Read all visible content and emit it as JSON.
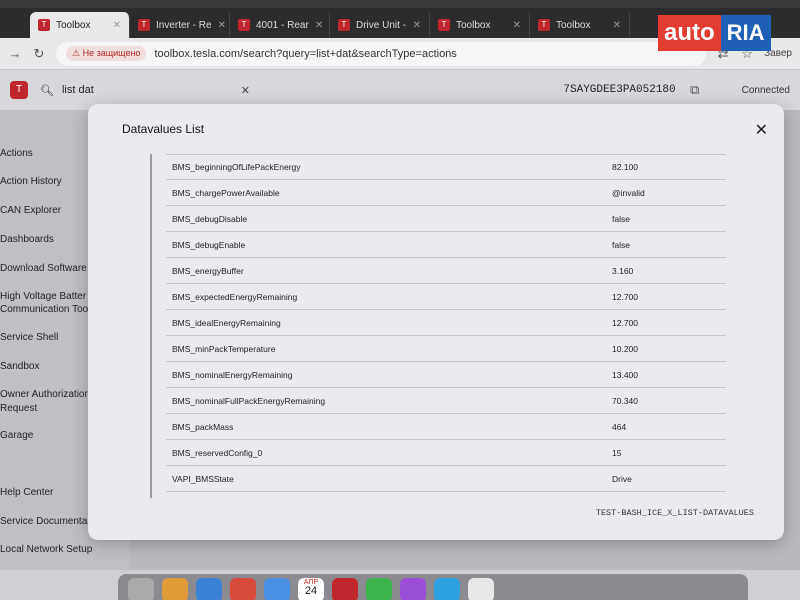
{
  "browser": {
    "tabs": [
      {
        "label": "Toolbox",
        "active": true
      },
      {
        "label": "Inverter - Re"
      },
      {
        "label": "4001 - Rear"
      },
      {
        "label": "Drive Unit -"
      },
      {
        "label": "Toolbox"
      },
      {
        "label": "Toolbox"
      }
    ],
    "security_label": "Не защищено",
    "url": "toolbox.tesla.com/search?query=list+dat&searchType=actions",
    "profile_label": "Завер"
  },
  "watermark": {
    "part1": "auto",
    "part2": "RIA"
  },
  "app": {
    "search_value": "list dat",
    "vin": "7SAYGDEE3PA052180",
    "connection_status": "Connected"
  },
  "sidebar": {
    "items": [
      {
        "label": "Actions"
      },
      {
        "label": "Action History"
      },
      {
        "label": "CAN Explorer"
      },
      {
        "label": "Dashboards"
      },
      {
        "label": "Download Software"
      },
      {
        "label": "High Voltage Batter"
      },
      {
        "label": "Communication Too"
      },
      {
        "label": "Service Shell"
      },
      {
        "label": "Sandbox"
      },
      {
        "label": "Owner Authorization"
      },
      {
        "label": "Request"
      },
      {
        "label": "Garage"
      },
      {
        "label": "Help Center"
      },
      {
        "label": "Service Documenta"
      },
      {
        "label": "Local Network Setup"
      }
    ]
  },
  "modal": {
    "title": "Datavalues List",
    "rows": [
      {
        "name": "BMS_beginningOfLifePackEnergy",
        "value": "82.100"
      },
      {
        "name": "BMS_chargePowerAvailable",
        "value": "@invalid"
      },
      {
        "name": "BMS_debugDisable",
        "value": "false"
      },
      {
        "name": "BMS_debugEnable",
        "value": "false"
      },
      {
        "name": "BMS_energyBuffer",
        "value": "3.160"
      },
      {
        "name": "BMS_expectedEnergyRemaining",
        "value": "12.700"
      },
      {
        "name": "BMS_idealEnergyRemaining",
        "value": "12.700"
      },
      {
        "name": "BMS_minPackTemperature",
        "value": "10.200"
      },
      {
        "name": "BMS_nominalEnergyRemaining",
        "value": "13.400"
      },
      {
        "name": "BMS_nominalFullPackEnergyRemaining",
        "value": "70.340"
      },
      {
        "name": "BMS_packMass",
        "value": "464"
      },
      {
        "name": "BMS_reservedConfig_0",
        "value": "15"
      },
      {
        "name": "VAPI_BMSState",
        "value": "Drive"
      }
    ],
    "footer_id": "TEST-BASH_ICE_X_LIST-DATAVALUES"
  },
  "dock": {
    "calendar_month": "АПР",
    "calendar_day": "24"
  }
}
